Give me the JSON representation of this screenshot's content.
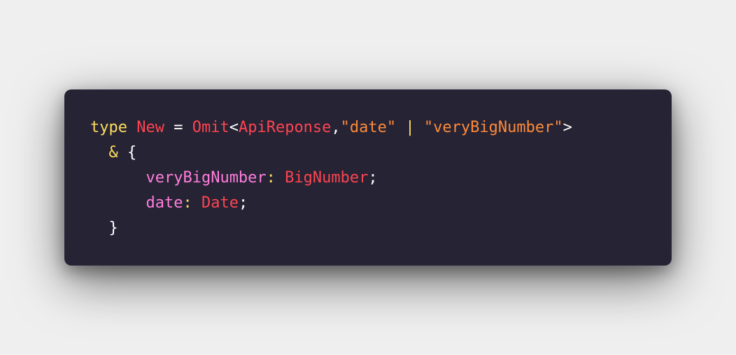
{
  "code": {
    "line1": {
      "keyword": "type",
      "type_name": "New",
      "equals": "=",
      "omit": "Omit",
      "open_angle": "<",
      "api_type": "ApiReponse",
      "comma": ",",
      "str_date": "\"date\"",
      "pipe": "|",
      "str_big": "\"veryBigNumber\"",
      "close_angle": ">"
    },
    "line2": {
      "amp": "&",
      "open_brace": "{"
    },
    "line3": {
      "prop": "veryBigNumber",
      "colon": ":",
      "type": "BigNumber",
      "semi": ";"
    },
    "line4": {
      "prop": "date",
      "colon": ":",
      "type": "Date",
      "semi": ";"
    },
    "line5": {
      "close_brace": "}"
    }
  },
  "colors": {
    "background": "#efefef",
    "card": "#262335",
    "keyword": "#fede5d",
    "type": "#fe4450",
    "string": "#ff8b39",
    "property": "#ff7edb",
    "plain": "#ffffff"
  }
}
